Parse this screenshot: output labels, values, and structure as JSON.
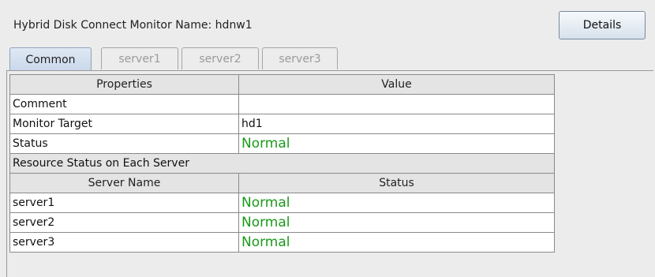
{
  "header": {
    "title": "Hybrid Disk Connect Monitor Name: hdnw1",
    "details_label": "Details"
  },
  "tabs": [
    {
      "label": "Common",
      "active": true
    },
    {
      "label": "server1",
      "active": false
    },
    {
      "label": "server2",
      "active": false
    },
    {
      "label": "server3",
      "active": false
    }
  ],
  "table": {
    "columns": [
      "Properties",
      "Value"
    ],
    "rows": [
      {
        "property": "Comment",
        "value": ""
      },
      {
        "property": "Monitor Target",
        "value": "hd1"
      },
      {
        "property": "Status",
        "value": "Normal"
      }
    ],
    "section_title": "Resource Status on Each Server",
    "server_columns": [
      "Server Name",
      "Status"
    ],
    "servers": [
      {
        "name": "server1",
        "status": "Normal"
      },
      {
        "name": "server2",
        "status": "Normal"
      },
      {
        "name": "server3",
        "status": "Normal"
      }
    ]
  },
  "colors": {
    "status_normal": "#1a9a1a",
    "active_tab": "#c9d8ea"
  }
}
